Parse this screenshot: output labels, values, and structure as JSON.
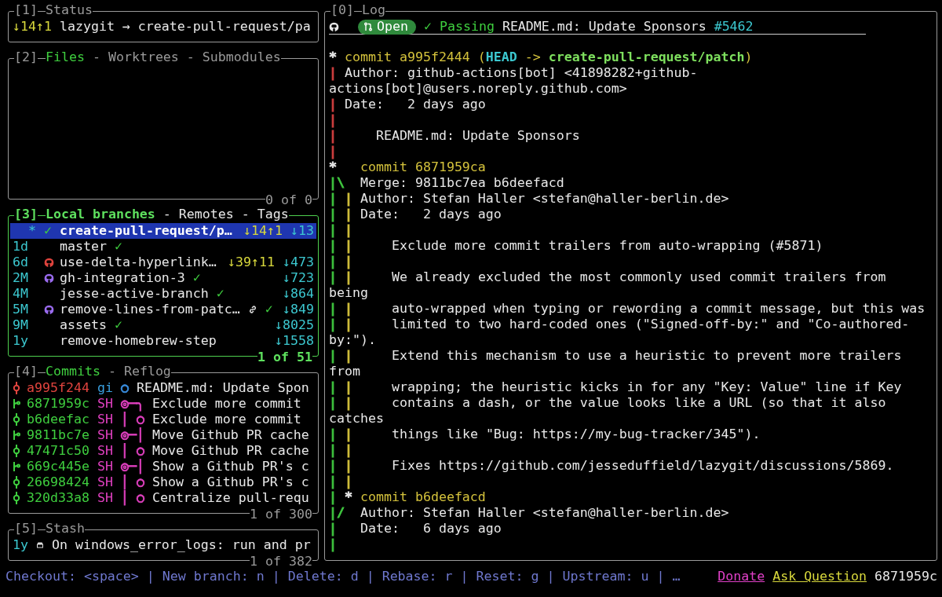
{
  "status": {
    "number": "[1]",
    "tabs": [
      {
        "label": "Status",
        "selected": false
      }
    ],
    "divergence": "↓14↑1",
    "text": "lazygit → create-pull-request/pa",
    "active": false
  },
  "files": {
    "number": "[2]",
    "tabs": [
      {
        "label": "Files",
        "selected": true
      },
      {
        "label": "Worktrees",
        "selected": false
      },
      {
        "label": "Submodules",
        "selected": false
      }
    ],
    "separator": "-",
    "footer": "0 of 0",
    "active": false
  },
  "branches": {
    "number": "[3]",
    "tabs": [
      {
        "label": "Local branches",
        "selected": true
      },
      {
        "label": "Remotes",
        "selected": false
      },
      {
        "label": "Tags",
        "selected": false
      }
    ],
    "separator": "-",
    "footer": "1 of 51",
    "active": true,
    "rows": [
      {
        "head": "*",
        "lead_check": "✓",
        "name": "create-pull-request/p…",
        "divergence": "↓14↑1",
        "behind": "↓13",
        "link": false,
        "selected": true
      },
      {
        "age": "1d",
        "name": "master",
        "check": "✓",
        "link": false,
        "selected": false
      },
      {
        "age": "6d",
        "pr_icon": {
          "color": "#e0443e"
        },
        "name": "use-delta-hyperlink…",
        "divergence": "↓39↑11",
        "behind": "↓473",
        "link": false,
        "selected": false
      },
      {
        "age": "2M",
        "pr_icon": {
          "color": "#9b6cf0"
        },
        "name": "gh-integration-3",
        "check": "✓",
        "behind": "↓723",
        "link": false,
        "selected": false
      },
      {
        "age": "4M",
        "name": "jesse-active-branch",
        "check": "✓",
        "behind": "↓864",
        "link": false,
        "selected": false
      },
      {
        "age": "5M",
        "pr_icon": {
          "color": "#9b6cf0"
        },
        "name": "remove-lines-from-patc…",
        "check": "✓",
        "behind": "↓849",
        "link": true,
        "selected": false
      },
      {
        "age": "9M",
        "name": "assets",
        "check": "✓",
        "behind": "↓8025",
        "link": false,
        "selected": false
      },
      {
        "age": "1y",
        "name": "remove-homebrew-step",
        "behind": "↓1558",
        "link": false,
        "selected": false
      }
    ]
  },
  "commits": {
    "number": "[4]",
    "tabs": [
      {
        "label": "Commits",
        "selected": true
      },
      {
        "label": "Reflog",
        "selected": false
      }
    ],
    "separator": "-",
    "footer": "1 of 300",
    "active": false,
    "rows": [
      {
        "kind": "commit",
        "color": "#e0443e",
        "hash": "a995f244",
        "author": {
          "text": "gi",
          "color": "#3aa0e0"
        },
        "graph": {
          "text": "○",
          "color": "#3a8ee0"
        },
        "message": "README.md: Update Spon"
      },
      {
        "kind": "merge",
        "color": "#3fcf3f",
        "hash": "6871959c",
        "author": {
          "text": "SH",
          "color": "#e040c0"
        },
        "graph": {
          "text": "◎─╮",
          "color": "#e040c0"
        },
        "message": "Exclude more commit"
      },
      {
        "kind": "commit",
        "color": "#3fcf3f",
        "hash": "b6deefac",
        "author": {
          "text": "SH",
          "color": "#e040c0"
        },
        "graph": {
          "text": "│ ○",
          "color": "#e040c0"
        },
        "message": "Exclude more commit"
      },
      {
        "kind": "merge",
        "color": "#3fcf3f",
        "hash": "9811bc7e",
        "author": {
          "text": "SH",
          "color": "#e040c0"
        },
        "graph": {
          "text": "◎─│",
          "color": "#e040c0"
        },
        "message": "Move Github PR cache"
      },
      {
        "kind": "commit",
        "color": "#3fcf3f",
        "hash": "47471c50",
        "author": {
          "text": "SH",
          "color": "#e040c0"
        },
        "graph": {
          "text": "│ ○",
          "color": "#e040c0"
        },
        "message": "Move Github PR cache"
      },
      {
        "kind": "merge",
        "color": "#3fcf3f",
        "hash": "669c445e",
        "author": {
          "text": "SH",
          "color": "#e040c0"
        },
        "graph": {
          "text": "◎─│",
          "color": "#e040c0"
        },
        "message": "Show a Github PR's c"
      },
      {
        "kind": "commit",
        "color": "#3fcf3f",
        "hash": "26698424",
        "author": {
          "text": "SH",
          "color": "#e040c0"
        },
        "graph": {
          "text": "│ ○",
          "color": "#e040c0"
        },
        "message": "Show a Github PR's c"
      },
      {
        "kind": "commit",
        "color": "#3fcf3f",
        "hash": "320d33a8",
        "author": {
          "text": "SH",
          "color": "#e040c0"
        },
        "graph": {
          "text": "│ ○",
          "color": "#e040c0"
        },
        "message": "Centralize pull-requ"
      }
    ]
  },
  "stash": {
    "number": "[5]",
    "tabs": [
      {
        "label": "Stash",
        "selected": false
      }
    ],
    "footer": "1 of 382",
    "active": false,
    "rows": [
      {
        "age": "1y",
        "message": "On windows_error_logs: run and pr"
      }
    ]
  },
  "log": {
    "number": "[0]",
    "tabs": [
      {
        "label": "Log",
        "selected": false
      }
    ],
    "active": false,
    "pr": {
      "state": "Open",
      "checks": "✓ Passing",
      "title": "README.md: Update Sponsors",
      "number": "#5462"
    },
    "blocks": [
      {
        "kind": "linear",
        "lines": [
          {
            "kind": "header",
            "graph": [
              {
                "char": "*",
                "color": "#e8e8e8",
                "kind": "lane"
              }
            ],
            "segments": [
              {
                "text": "commit a995f2444 (",
                "kind": "commit"
              },
              {
                "text": "HEAD",
                "kind": "head"
              },
              {
                "text": " -> ",
                "kind": "commit"
              },
              {
                "text": "create-pull-request/patch",
                "kind": "branch"
              },
              {
                "text": ")",
                "kind": "commit"
              }
            ]
          },
          {
            "kind": "field",
            "graph": [
              {
                "char": "|",
                "color": "#d23f3f",
                "kind": "lane"
              }
            ],
            "text": "Author: github-actions[bot] <41898282+github-"
          },
          {
            "kind": "wrap",
            "text": "actions[bot]@users.noreply.github.com>"
          },
          {
            "kind": "field",
            "graph": [
              {
                "char": "|",
                "color": "#d23f3f",
                "kind": "lane"
              }
            ],
            "text": "Date:   2 days ago"
          },
          {
            "kind": "blank",
            "graph": [
              {
                "char": "|",
                "color": "#d23f3f",
                "kind": "lane"
              }
            ]
          },
          {
            "kind": "message",
            "graph": [
              {
                "char": "|",
                "color": "#d23f3f",
                "kind": "lane"
              }
            ],
            "text": "README.md: Update Sponsors"
          },
          {
            "kind": "blank",
            "graph": [
              {
                "char": "|",
                "color": "#d23f3f",
                "kind": "lane"
              }
            ]
          }
        ]
      },
      {
        "kind": "branched",
        "lines": [
          {
            "kind": "header",
            "graph": [
              {
                "char": "*",
                "color": "#e8e8e8",
                "kind": "lane"
              }
            ],
            "segments": [
              {
                "text": "commit 6871959ca",
                "kind": "commit"
              }
            ]
          },
          {
            "kind": "field",
            "graph": [
              {
                "char": "|",
                "color": "#3fc53f",
                "kind": "lane"
              },
              {
                "char": "\\",
                "color": "#3fc53f",
                "kind": "edge"
              }
            ],
            "text": "Merge: 9811bc7ea b6deefacd"
          },
          {
            "kind": "field",
            "graph": [
              {
                "char": "|",
                "color": "#3fc53f",
                "kind": "lane"
              },
              {
                "char": "|",
                "color": "#d4c23c",
                "kind": "lane"
              }
            ],
            "text": "Author: Stefan Haller <stefan@haller-berlin.de>"
          },
          {
            "kind": "field",
            "graph": [
              {
                "char": "|",
                "color": "#3fc53f",
                "kind": "lane"
              },
              {
                "char": "|",
                "color": "#d4c23c",
                "kind": "lane"
              }
            ],
            "text": "Date:   2 days ago"
          },
          {
            "kind": "blank",
            "graph": [
              {
                "char": "|",
                "color": "#3fc53f",
                "kind": "lane"
              },
              {
                "char": "|",
                "color": "#d4c23c",
                "kind": "lane"
              }
            ]
          },
          {
            "kind": "message",
            "graph": [
              {
                "char": "|",
                "color": "#3fc53f",
                "kind": "lane"
              },
              {
                "char": "|",
                "color": "#d4c23c",
                "kind": "lane"
              }
            ],
            "text": "Exclude more commit trailers from auto-wrapping (#5871)"
          },
          {
            "kind": "blank",
            "graph": [
              {
                "char": "|",
                "color": "#3fc53f",
                "kind": "lane"
              },
              {
                "char": "|",
                "color": "#d4c23c",
                "kind": "lane"
              }
            ]
          },
          {
            "kind": "message",
            "graph": [
              {
                "char": "|",
                "color": "#3fc53f",
                "kind": "lane"
              },
              {
                "char": "|",
                "color": "#d4c23c",
                "kind": "lane"
              }
            ],
            "text": "We already excluded the most commonly used commit trailers from"
          },
          {
            "kind": "wrap",
            "text": "being"
          },
          {
            "kind": "message",
            "graph": [
              {
                "char": "|",
                "color": "#3fc53f",
                "kind": "lane"
              },
              {
                "char": "|",
                "color": "#d4c23c",
                "kind": "lane"
              }
            ],
            "text": "auto-wrapped when typing or rewording a commit message, but this was"
          },
          {
            "kind": "message",
            "graph": [
              {
                "char": "|",
                "color": "#3fc53f",
                "kind": "lane"
              },
              {
                "char": "|",
                "color": "#d4c23c",
                "kind": "lane"
              }
            ],
            "text": "limited to two hard-coded ones (\"Signed-off-by:\" and \"Co-authored-"
          },
          {
            "kind": "wrap",
            "text": "by:\")."
          },
          {
            "kind": "message",
            "graph": [
              {
                "char": "|",
                "color": "#3fc53f",
                "kind": "lane"
              },
              {
                "char": "|",
                "color": "#d4c23c",
                "kind": "lane"
              }
            ],
            "text": "Extend this mechanism to use a heuristic to prevent more trailers"
          },
          {
            "kind": "wrap",
            "text": "from"
          },
          {
            "kind": "message",
            "graph": [
              {
                "char": "|",
                "color": "#3fc53f",
                "kind": "lane"
              },
              {
                "char": "|",
                "color": "#d4c23c",
                "kind": "lane"
              }
            ],
            "text": "wrapping; the heuristic kicks in for any \"Key: Value\" line if Key"
          },
          {
            "kind": "message",
            "graph": [
              {
                "char": "|",
                "color": "#3fc53f",
                "kind": "lane"
              },
              {
                "char": "|",
                "color": "#d4c23c",
                "kind": "lane"
              }
            ],
            "text": "contains a dash, or the value looks like a URL (so that it also"
          },
          {
            "kind": "wrap",
            "text": "catches"
          },
          {
            "kind": "message",
            "graph": [
              {
                "char": "|",
                "color": "#3fc53f",
                "kind": "lane"
              },
              {
                "char": "|",
                "color": "#d4c23c",
                "kind": "lane"
              }
            ],
            "text": "things like \"Bug: https://my-bug-tracker/345\")."
          },
          {
            "kind": "blank",
            "graph": [
              {
                "char": "|",
                "color": "#3fc53f",
                "kind": "lane"
              },
              {
                "char": "|",
                "color": "#d4c23c",
                "kind": "lane"
              }
            ]
          },
          {
            "kind": "message",
            "graph": [
              {
                "char": "|",
                "color": "#3fc53f",
                "kind": "lane"
              },
              {
                "char": "|",
                "color": "#d4c23c",
                "kind": "lane"
              }
            ],
            "text": "Fixes https://github.com/jesseduffield/lazygit/discussions/5869."
          },
          {
            "kind": "blank",
            "graph": [
              {
                "char": "|",
                "color": "#3fc53f",
                "kind": "lane"
              },
              {
                "char": "|",
                "color": "#d4c23c",
                "kind": "lane"
              }
            ]
          },
          {
            "kind": "header",
            "graph": [
              {
                "char": "|",
                "color": "#3fc53f",
                "kind": "lane"
              },
              {
                "char": "*",
                "color": "#e8e8e8",
                "kind": "lane"
              }
            ],
            "segments": [
              {
                "text": "commit b6deefacd",
                "kind": "commit"
              }
            ]
          },
          {
            "kind": "field",
            "graph": [
              {
                "char": "|",
                "color": "#3fc53f",
                "kind": "lane"
              },
              {
                "char": "/",
                "color": "#3fc53f",
                "kind": "edge"
              }
            ],
            "text": "Author: Stefan Haller <stefan@haller-berlin.de>"
          },
          {
            "kind": "field",
            "graph": [
              {
                "char": "|",
                "color": "#3fc53f",
                "kind": "lane"
              }
            ],
            "text": "Date:   6 days ago"
          },
          {
            "kind": "blank",
            "graph": [
              {
                "char": "|",
                "color": "#3fc53f",
                "kind": "lane"
              }
            ]
          }
        ]
      }
    ]
  },
  "bottom_bar": {
    "hints": [
      "Checkout: <space>",
      "New branch: n",
      "Delete: d",
      "Rebase: r",
      "Reset: g",
      "Upstream: u"
    ],
    "separator": "|",
    "more": "…",
    "links": [
      {
        "label": "Donate",
        "color": "#e040c8"
      },
      {
        "label": "Ask Question",
        "color": "#d8d83c"
      }
    ],
    "hash": "6871959c"
  }
}
